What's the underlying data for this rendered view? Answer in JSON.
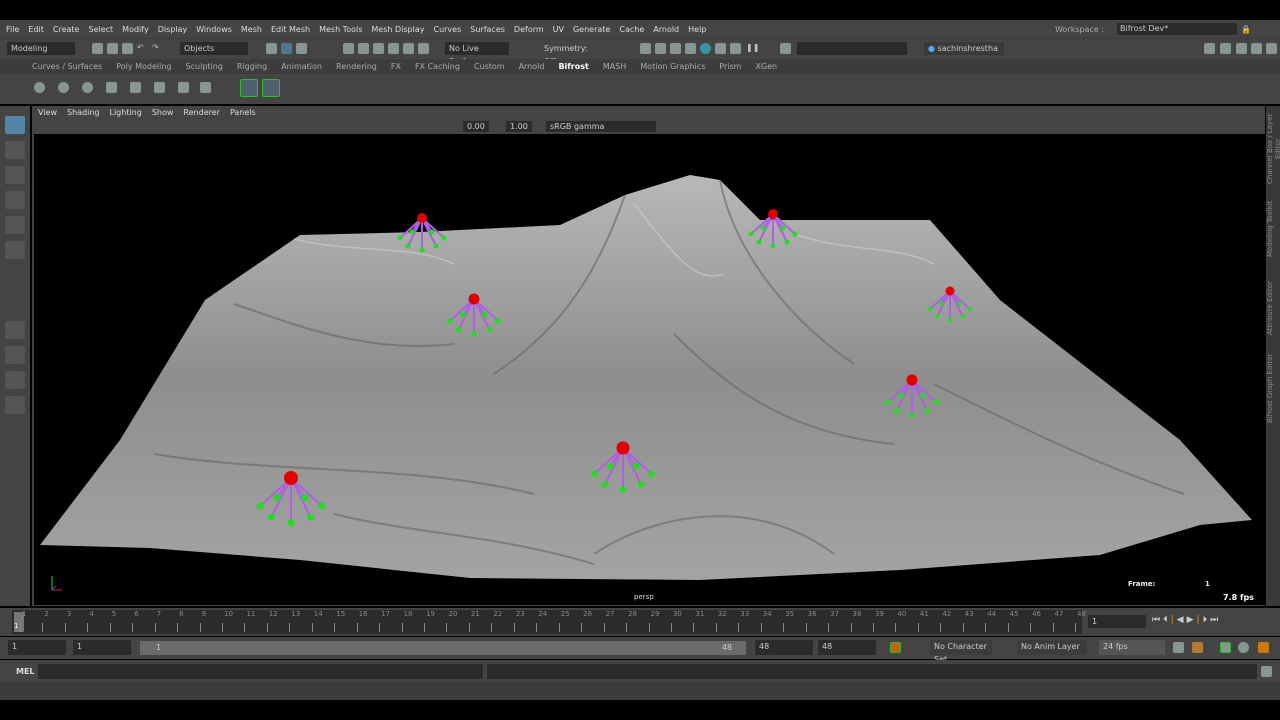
{
  "menus": [
    "File",
    "Edit",
    "Create",
    "Select",
    "Modify",
    "Display",
    "Windows",
    "Mesh",
    "Edit Mesh",
    "Mesh Tools",
    "Mesh Display",
    "Curves",
    "Surfaces",
    "Deform",
    "UV",
    "Generate",
    "Cache",
    "Arnold",
    "Help"
  ],
  "workspace": {
    "label": "Workspace :",
    "value": "Bifrost Dev*"
  },
  "status": {
    "menuset": "Modeling",
    "objects": "Objects",
    "live_surface": "No Live Surface",
    "symmetry": "Symmetry: Off",
    "user": "sachinshrestha"
  },
  "shelf_tabs": [
    "Curves / Surfaces",
    "Poly Modeling",
    "Sculpting",
    "Rigging",
    "Animation",
    "Rendering",
    "FX",
    "FX Caching",
    "Custom",
    "Arnold",
    "Bifrost",
    "MASH",
    "Motion Graphics",
    "Prism",
    "XGen"
  ],
  "active_shelf": "Bifrost",
  "viewport": {
    "menus": [
      "View",
      "Shading",
      "Lighting",
      "Show",
      "Renderer",
      "Panels"
    ],
    "exposure": "0.00",
    "gamma": "1.00",
    "colorspace": "sRGB gamma",
    "camera": "persp",
    "frame_label": "Frame:",
    "frame_value": "1",
    "fps": "7.8 fps"
  },
  "right_tabs": [
    "Channel Box / Layer Editor",
    "Modeling Toolkit",
    "Attribute Editor",
    "Bifrost Graph Editor"
  ],
  "timeline": {
    "start": 1,
    "end": 48,
    "current": "1",
    "current_field": "1"
  },
  "range": {
    "start": "1",
    "anim_start": "1",
    "slider_start": "1",
    "slider_end": "48",
    "end": "48",
    "anim_end": "48",
    "character_set": "No Character Set",
    "anim_layer": "No Anim Layer",
    "fps": "24 fps"
  },
  "cmd": {
    "label": "MEL"
  },
  "colors": {
    "accent": "#5285a6",
    "marker": "#e00000",
    "dot": "#22dd22",
    "leg": "#b060e0"
  }
}
